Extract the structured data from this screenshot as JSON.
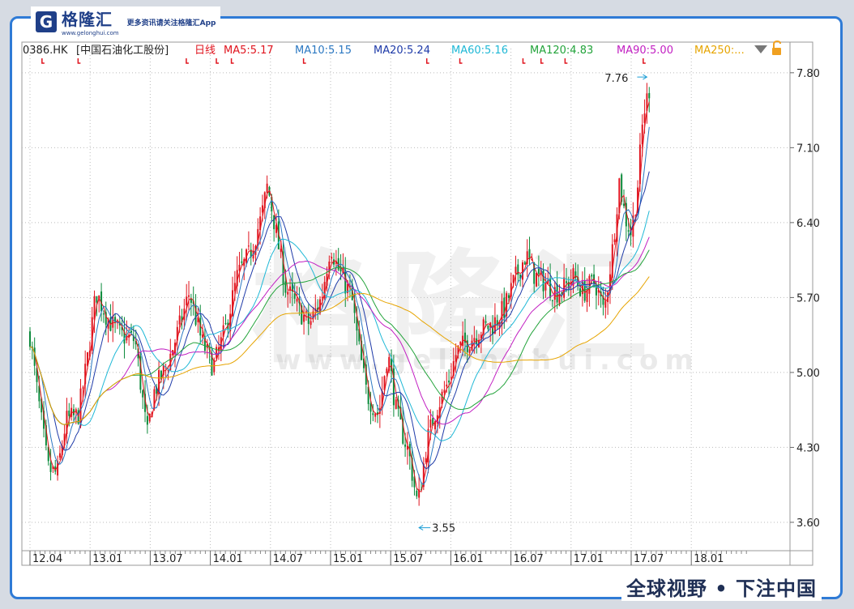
{
  "logo": {
    "name": "格隆汇",
    "sub": "www.gelonghui.com",
    "tagline": "更多资讯请关注格隆汇App"
  },
  "footer": "全球视野 • 下注中国",
  "watermark": {
    "big": "格隆汇",
    "url": "www.gelonghui.com"
  },
  "colors": {
    "up": "#e0141e",
    "down": "#0a8a3a",
    "ma5": "#e0141e",
    "ma10": "#2b78c2",
    "ma20": "#1e3aa8",
    "ma60": "#1fb8d6",
    "ma120": "#22a33a",
    "ma90": "#c21fc2",
    "ma250": "#e6a400",
    "frame": "#2f7bd6"
  },
  "header": {
    "symbol": "0386.HK",
    "name": "[中国石油化工股份]",
    "period": "日线",
    "mas": [
      {
        "key": "ma5",
        "label": "MA5:5.17"
      },
      {
        "key": "ma10",
        "label": "MA10:5.15"
      },
      {
        "key": "ma20",
        "label": "MA20:5.24"
      },
      {
        "key": "ma60",
        "label": "MA60:5.16"
      },
      {
        "key": "ma120",
        "label": "MA120:4.83"
      },
      {
        "key": "ma90",
        "label": "MA90:5.00"
      },
      {
        "key": "ma250",
        "label": "MA250:..."
      }
    ]
  },
  "chart_data": {
    "type": "candlestick",
    "x_labels": [
      "12.04",
      "13.01",
      "13.07",
      "14.01",
      "14.07",
      "15.01",
      "15.07",
      "16.01",
      "16.07",
      "17.01",
      "17.07",
      "18.01"
    ],
    "y_ticks": [
      7.8,
      7.1,
      6.4,
      5.7,
      5.0,
      4.3,
      3.6
    ],
    "ylim": [
      3.35,
      7.95
    ],
    "annotations": [
      {
        "label": "7.76",
        "value": 7.76,
        "kind": "high"
      },
      {
        "label": "3.55",
        "value": 3.55,
        "kind": "low"
      }
    ],
    "price_path": [
      [
        0,
        5.35
      ],
      [
        0.1,
        4.9
      ],
      [
        0.3,
        4.1
      ],
      [
        0.45,
        4.05
      ],
      [
        0.6,
        4.55
      ],
      [
        0.8,
        4.6
      ],
      [
        0.95,
        5.1
      ],
      [
        1.1,
        5.75
      ],
      [
        1.3,
        5.5
      ],
      [
        1.5,
        5.35
      ],
      [
        1.75,
        5.3
      ],
      [
        1.95,
        4.4
      ],
      [
        2.05,
        4.8
      ],
      [
        2.3,
        5.1
      ],
      [
        2.5,
        5.45
      ],
      [
        2.65,
        5.75
      ],
      [
        2.85,
        5.3
      ],
      [
        3.05,
        5.05
      ],
      [
        3.25,
        5.4
      ],
      [
        3.45,
        5.9
      ],
      [
        3.65,
        6.1
      ],
      [
        3.85,
        6.45
      ],
      [
        3.95,
        6.75
      ],
      [
        4.05,
        6.45
      ],
      [
        4.25,
        5.8
      ],
      [
        4.45,
        5.6
      ],
      [
        4.65,
        5.45
      ],
      [
        4.85,
        5.7
      ],
      [
        5.0,
        6.2
      ],
      [
        5.1,
        6.0
      ],
      [
        5.35,
        5.7
      ],
      [
        5.45,
        5.3
      ],
      [
        5.6,
        4.8
      ],
      [
        5.8,
        4.6
      ],
      [
        5.95,
        5.2
      ],
      [
        6.1,
        4.6
      ],
      [
        6.3,
        4.25
      ],
      [
        6.45,
        3.75
      ],
      [
        6.6,
        4.35
      ],
      [
        6.75,
        4.65
      ],
      [
        6.95,
        4.9
      ],
      [
        7.1,
        5.2
      ],
      [
        7.3,
        5.3
      ],
      [
        7.5,
        5.4
      ],
      [
        7.7,
        5.45
      ],
      [
        7.9,
        5.6
      ],
      [
        8.05,
        5.85
      ],
      [
        8.25,
        6.1
      ],
      [
        8.4,
        5.9
      ],
      [
        8.55,
        5.85
      ],
      [
        8.75,
        5.75
      ],
      [
        8.9,
        5.8
      ],
      [
        9.05,
        5.9
      ],
      [
        9.2,
        5.75
      ],
      [
        9.4,
        5.85
      ],
      [
        9.55,
        5.55
      ],
      [
        9.7,
        6.2
      ],
      [
        9.8,
        6.8
      ],
      [
        9.9,
        6.45
      ],
      [
        10.0,
        6.3
      ],
      [
        10.1,
        6.7
      ],
      [
        10.2,
        7.4
      ],
      [
        10.3,
        7.65
      ]
    ]
  }
}
